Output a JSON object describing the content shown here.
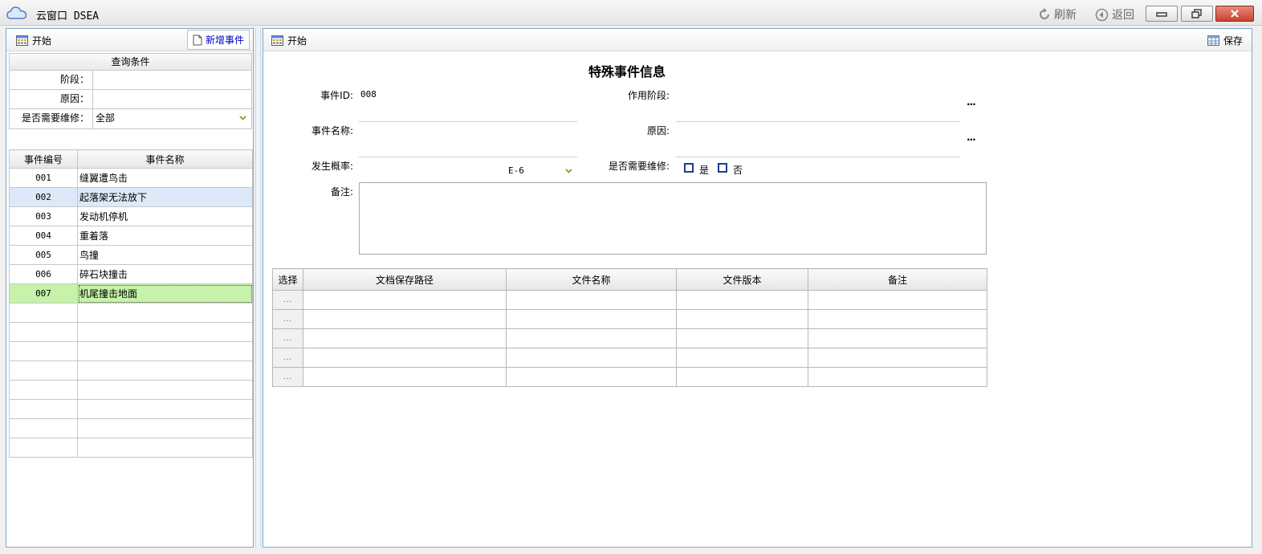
{
  "window": {
    "title": "云窗口 DSEA",
    "refresh_label": "刷新",
    "back_label": "返回"
  },
  "left": {
    "start_label": "开始",
    "add_event_label": "新增事件",
    "query": {
      "header": "查询条件",
      "stage_label": "阶段：",
      "stage_value": "",
      "reason_label": "原因：",
      "reason_value": "",
      "repair_label": "是否需要维修：",
      "repair_value": "全部"
    },
    "columns": [
      "事件编号",
      "事件名称"
    ],
    "rows": [
      {
        "id": "001",
        "name": "缝翼遭鸟击"
      },
      {
        "id": "002",
        "name": "起落架无法放下"
      },
      {
        "id": "003",
        "name": "发动机停机"
      },
      {
        "id": "004",
        "name": "重着落"
      },
      {
        "id": "005",
        "name": "鸟撞"
      },
      {
        "id": "006",
        "name": "碎石块撞击"
      },
      {
        "id": "007",
        "name": "机尾撞击地面"
      },
      {
        "id": "",
        "name": ""
      },
      {
        "id": "",
        "name": ""
      },
      {
        "id": "",
        "name": ""
      },
      {
        "id": "",
        "name": ""
      },
      {
        "id": "",
        "name": ""
      },
      {
        "id": "",
        "name": ""
      },
      {
        "id": "",
        "name": ""
      },
      {
        "id": "",
        "name": ""
      }
    ]
  },
  "right": {
    "start_label": "开始",
    "save_label": "保存",
    "form_title": "特殊事件信息",
    "event_id_label": "事件ID:",
    "event_id_value": "008",
    "stage_label": "作用阶段:",
    "event_name_label": "事件名称:",
    "reason_label": "原因:",
    "probability_label": "发生概率:",
    "probability_value": "E-6",
    "repair_label": "是否需要维修:",
    "yes_label": "是",
    "no_label": "否",
    "notes_label": "备注:",
    "more_dots": "...",
    "doc_columns": [
      "选择",
      "文档保存路径",
      "文件名称",
      "文件版本",
      "备注"
    ],
    "doc_row_selector": "...",
    "doc_rows": 5
  },
  "colors": {
    "selected_green": "#c6f2a9",
    "selected_blue": "#dde9f8",
    "checkbox_blue": "#1c3d8c",
    "close_red": "#c64230"
  }
}
